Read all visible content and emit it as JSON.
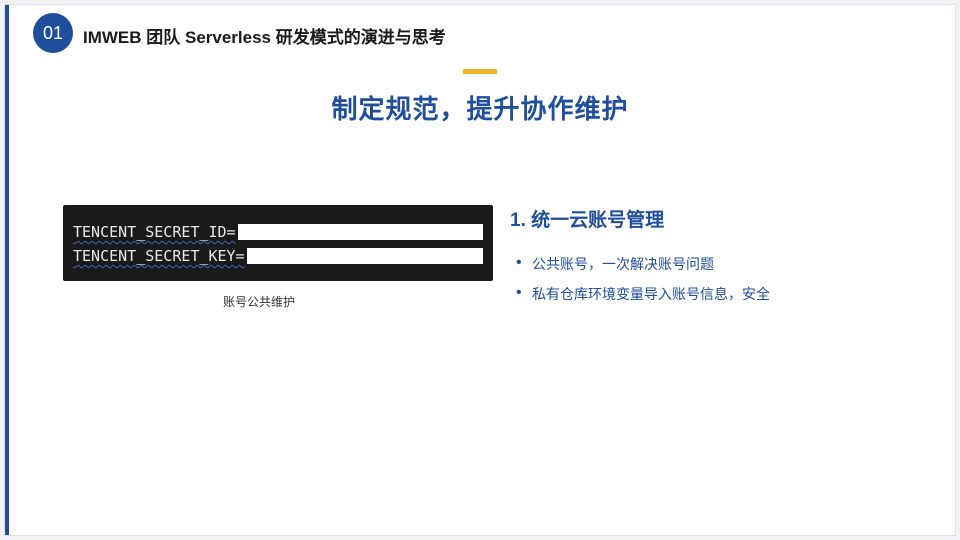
{
  "header": {
    "number": "01",
    "title": "IMWEB 团队 Serverless 研发模式的演进与思考"
  },
  "main": {
    "title": "制定规范，提升协作维护"
  },
  "codeblock": {
    "lines": [
      "TENCENT_SECRET_ID=",
      "TENCENT_SECRET_KEY="
    ],
    "caption": "账号公共维护"
  },
  "section": {
    "heading": "1. 统一云账号管理",
    "bullets": [
      "公共账号，一次解决账号问题",
      "私有仓库环境变量导入账号信息，安全"
    ]
  }
}
